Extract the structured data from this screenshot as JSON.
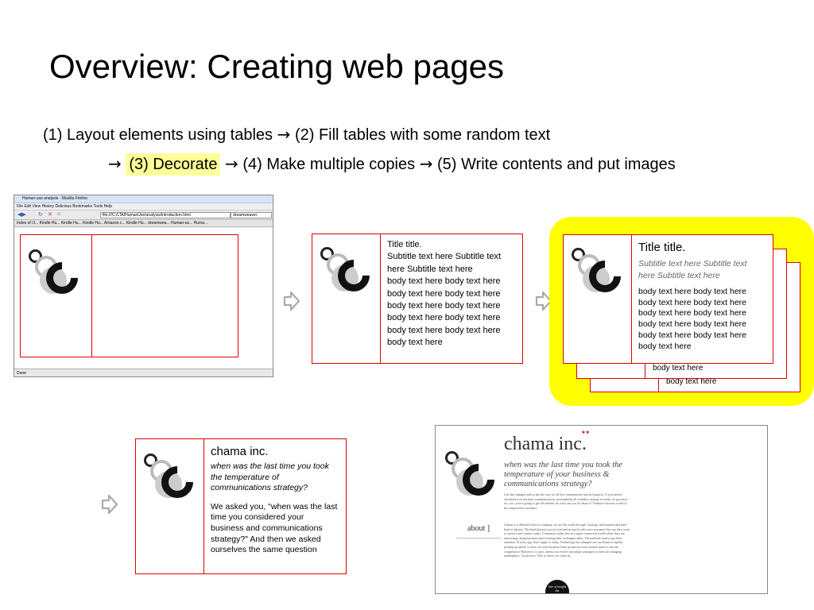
{
  "slide": {
    "title": "Overview: Creating web pages",
    "steps_line1": {
      "s1": "(1) Layout elements using tables",
      "s2": "(2) Fill tables with some random text"
    },
    "steps_line2": {
      "s3": "(3) Decorate",
      "s4": "(4) Make multiple copies",
      "s5": "(5) Write contents and put images"
    },
    "highlight_color": "#ffff99",
    "arrow_glyph": "→"
  },
  "browser": {
    "window_title": "Human-use analysis - Mozilla Firefox",
    "menu": "File   Edit   View   History   Delicious   Bookmarks   Tools   Help",
    "url": "file:///C:/LTA/HumanUse/analysis/introduction.html",
    "search": "dreamweaver",
    "bookmarks": "Index of /J...   Kindle Hu...   Kindle Hu...   Kindle Hu...   Amazon.c...   Kindle Hu...   dreamwea...   Human-us...   Huma...",
    "status": "Done"
  },
  "card_text": {
    "title": "Title title.",
    "subtitle": "Subtitle text here Subtitle text here Subtitle text here",
    "body": "body text here body text here body text here body text here body text here body text here body text here body text here body text here body text here body text here",
    "body_short": "body text here"
  },
  "card_contents": {
    "company": "chama inc.",
    "tagline": "when was the last time you took the temperature of communications strategy?",
    "body": "We asked you, \"when was the last time you considered your business and communications strategy?\" And then we asked ourselves the same question"
  },
  "website": {
    "name": "chama inc.",
    "tagline": "when was the last time you took the temperature of your business & communications strategy?",
    "para1": "Life has changed and so has the way we all live communicate and do business. If you haven't refreshed your business communication, sustainability & visibility strategy recently, we got news for you...you're going to get left behind. So what can you do about it? Embrace the new world of the empowered consumer.",
    "para2": "Chama is a different kind of company, we see the world through \"strategic information that lasts\" kind of glasses. The kind that put you in front and in touch with your customers the way they want to interact and connect today. Consumers today live in a super-connected world where they are interacting, doing business and evolving their exchanges daily. The methods used to get their attention 10 years ago, don't apply to today. Technology has changed our world and is rapidly picking up speed, so how can your business keep up and not loose market share to nervier competitors? Bad news: it can't, unless you evolve and adopt strategies to meet the changing marketplace. Good news: This is where we come in...",
    "about": "about ]",
    "badge": "line of insight the"
  }
}
